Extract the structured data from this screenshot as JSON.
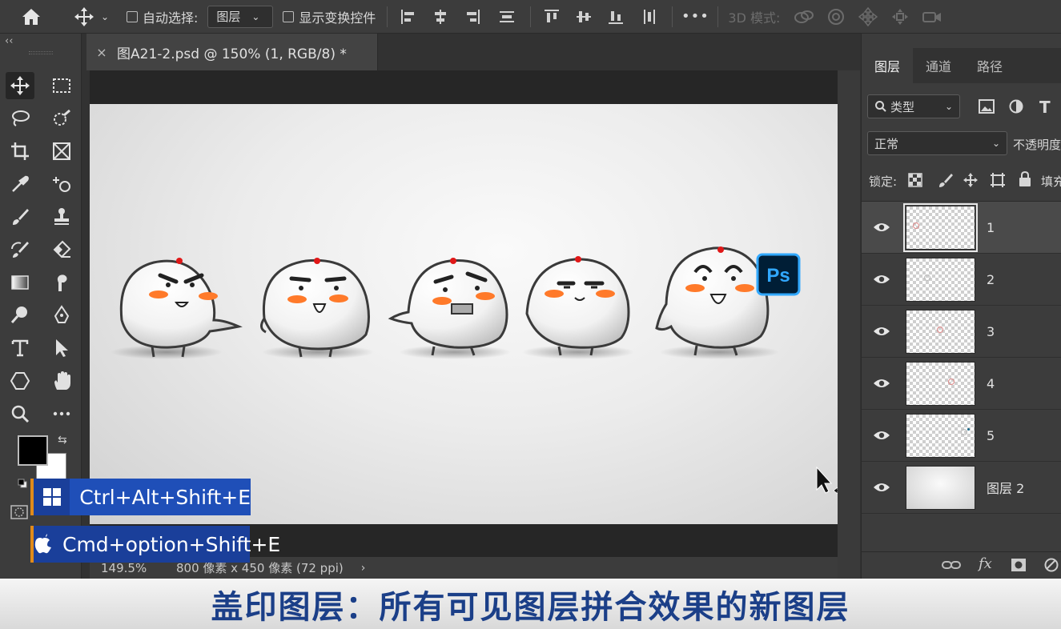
{
  "optionsBar": {
    "autoSelectLabel": "自动选择:",
    "autoSelectValue": "图层",
    "showTransformLabel": "显示变换控件",
    "mode3dLabel": "3D 模式:",
    "moreLabel": "•••"
  },
  "document": {
    "tabTitle": "图A21-2.psd @ 150% (1, RGB/8) *",
    "closeGlyph": "×",
    "zoom": "149.5%",
    "info": "800 像素 x 450 像素 (72 ppi)"
  },
  "badge": {
    "text": "Ps"
  },
  "shortcuts": {
    "windows": "Ctrl+Alt+Shift+E",
    "mac": "Cmd+option+Shift+E"
  },
  "layersPanel": {
    "tabs": [
      "图层",
      "通道",
      "路径"
    ],
    "filterLabel": "类型",
    "blendMode": "正常",
    "opacityLabel": "不透明度",
    "lockLabel": "锁定:",
    "fillLabel": "填充",
    "layers": [
      {
        "name": "1",
        "selected": true
      },
      {
        "name": "2",
        "selected": false
      },
      {
        "name": "3",
        "selected": false
      },
      {
        "name": "4",
        "selected": false
      },
      {
        "name": "5",
        "selected": false
      },
      {
        "name": "图层 2",
        "selected": false
      }
    ],
    "fxLabel": "fx"
  },
  "caption": "盖印图层：所有可见图层拼合效果的新图层",
  "colors": {
    "accentBlue": "#1f4fb8",
    "captionBlue": "#1b3f88",
    "blush": "#ff7a2a",
    "topDot": "#e01818",
    "psBlue": "#31a8ff"
  }
}
